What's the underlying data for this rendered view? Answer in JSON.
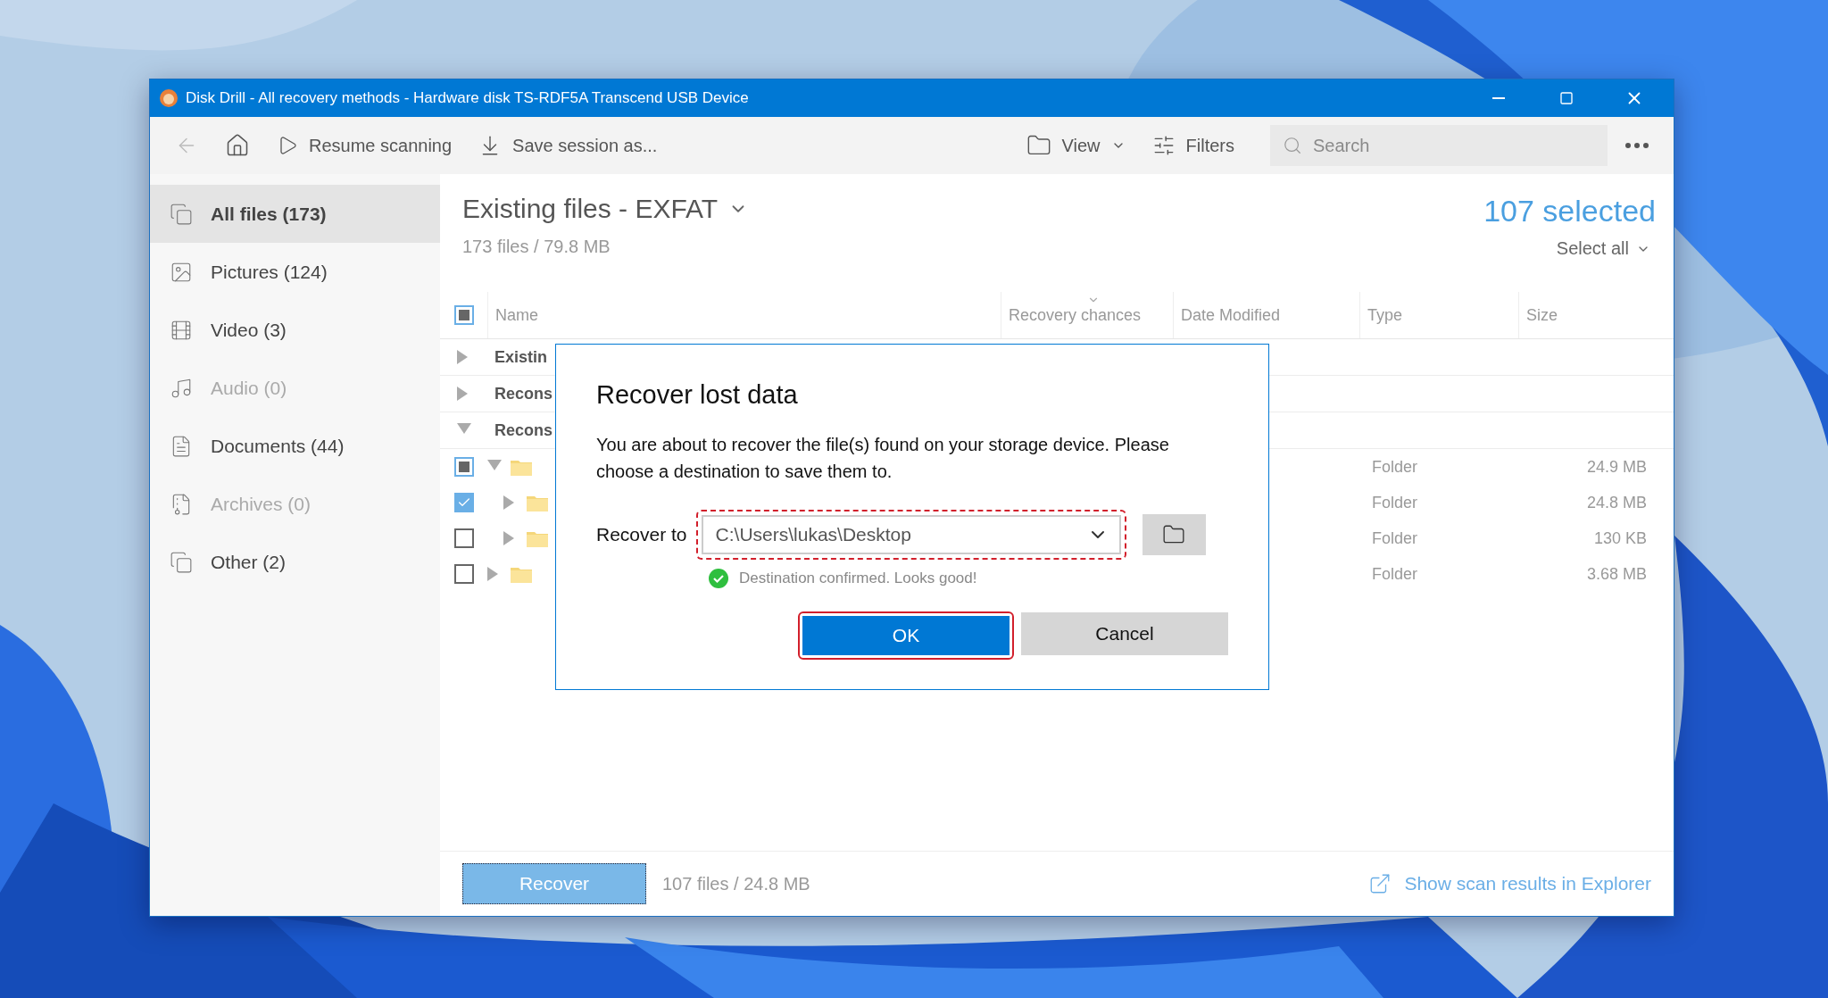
{
  "window": {
    "title": "Disk Drill - All recovery methods - Hardware disk TS-RDF5A Transcend USB Device"
  },
  "toolbar": {
    "back_disabled": true,
    "resume": "Resume scanning",
    "save": "Save session as...",
    "view": "View",
    "filters": "Filters",
    "search_placeholder": "Search"
  },
  "sidebar": {
    "items": [
      {
        "label": "All files (173)",
        "selected": true,
        "disabled": false
      },
      {
        "label": "Pictures (124)",
        "selected": false,
        "disabled": false
      },
      {
        "label": "Video (3)",
        "selected": false,
        "disabled": false
      },
      {
        "label": "Audio (0)",
        "selected": false,
        "disabled": true
      },
      {
        "label": "Documents (44)",
        "selected": false,
        "disabled": false
      },
      {
        "label": "Archives (0)",
        "selected": false,
        "disabled": true
      },
      {
        "label": "Other (2)",
        "selected": false,
        "disabled": false
      }
    ]
  },
  "header": {
    "title": "Existing files - EXFAT",
    "summary": "173 files / 79.8 MB",
    "selected_count": "107 selected",
    "select_all": "Select all"
  },
  "table": {
    "header_checked": false,
    "header_partial": true,
    "columns": [
      {
        "label": "Name",
        "sorted": false
      },
      {
        "label": "Recovery chances",
        "sorted": true
      },
      {
        "label": "Date Modified",
        "sorted": false
      },
      {
        "label": "Type",
        "sorted": false
      },
      {
        "label": "Size",
        "sorted": false
      }
    ],
    "rows": [
      {
        "kind": "group",
        "name": "Existin",
        "expanded": false
      },
      {
        "kind": "group",
        "name": "Recons",
        "expanded": false
      },
      {
        "kind": "group",
        "name": "Recons",
        "expanded": true,
        "children": [
          {
            "kind": "folder",
            "checked": false,
            "partial": true,
            "expanded": true,
            "type": "Folder",
            "size": "24.9 MB",
            "children": [
              {
                "kind": "folder",
                "checked": true,
                "partial": false,
                "expanded": false,
                "type": "Folder",
                "size": "24.8 MB"
              },
              {
                "kind": "folder",
                "checked": false,
                "partial": false,
                "expanded": false,
                "type": "Folder",
                "size": "130 KB"
              }
            ]
          },
          {
            "kind": "folder",
            "checked": false,
            "partial": false,
            "expanded": false,
            "type": "Folder",
            "size": "3.68 MB"
          }
        ]
      }
    ]
  },
  "dialog": {
    "title": "Recover lost data",
    "message": "You are about to recover the file(s) found on your storage device. Please choose a destination to save them to.",
    "field_label": "Recover to",
    "path": "C:\\Users\\lukas\\Desktop",
    "status": "Destination confirmed. Looks good!",
    "ok": "OK",
    "cancel": "Cancel"
  },
  "footer": {
    "recover": "Recover",
    "summary": "107 files / 24.8 MB",
    "explorer_link": "Show scan results in Explorer"
  }
}
